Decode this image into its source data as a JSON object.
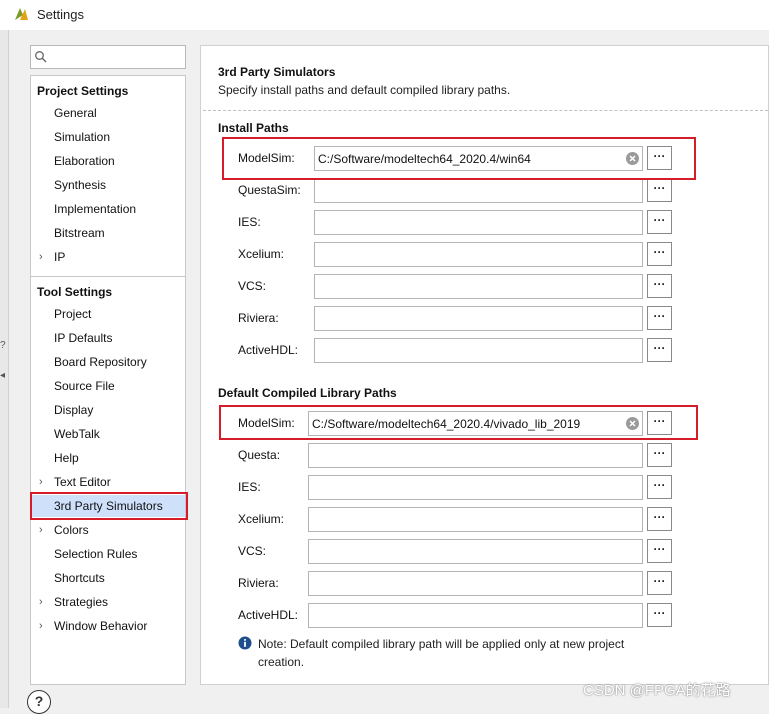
{
  "window": {
    "title": "Settings"
  },
  "search": {
    "placeholder": ""
  },
  "sidebar": {
    "project_settings_header": "Project Settings",
    "project_items": [
      "General",
      "Simulation",
      "Elaboration",
      "Synthesis",
      "Implementation",
      "Bitstream",
      "IP"
    ],
    "tool_settings_header": "Tool Settings",
    "tool_items": [
      "Project",
      "IP Defaults",
      "Board Repository",
      "Source File",
      "Display",
      "WebTalk",
      "Help",
      "Text Editor",
      "3rd Party Simulators",
      "Colors",
      "Selection Rules",
      "Shortcuts",
      "Strategies",
      "Window Behavior"
    ],
    "selected_item": "3rd Party Simulators"
  },
  "main": {
    "title": "3rd Party Simulators",
    "description": "Specify install paths and default compiled library paths.",
    "install_paths": {
      "header": "Install Paths",
      "rows": [
        {
          "label": "ModelSim:",
          "value": "C:/Software/modeltech64_2020.4/win64"
        },
        {
          "label": "QuestaSim:",
          "value": ""
        },
        {
          "label": "IES:",
          "value": ""
        },
        {
          "label": "Xcelium:",
          "value": ""
        },
        {
          "label": "VCS:",
          "value": ""
        },
        {
          "label": "Riviera:",
          "value": ""
        },
        {
          "label": "ActiveHDL:",
          "value": ""
        }
      ]
    },
    "library_paths": {
      "header": "Default Compiled Library Paths",
      "rows": [
        {
          "label": "ModelSim:",
          "value": "C:/Software/modeltech64_2020.4/vivado_lib_2019"
        },
        {
          "label": "Questa:",
          "value": ""
        },
        {
          "label": "IES:",
          "value": ""
        },
        {
          "label": "Xcelium:",
          "value": ""
        },
        {
          "label": "VCS:",
          "value": ""
        },
        {
          "label": "Riviera:",
          "value": ""
        },
        {
          "label": "ActiveHDL:",
          "value": ""
        }
      ]
    },
    "browse_label": "···",
    "note": "Note: Default compiled library path will be applied only at new project creation."
  },
  "help_button": {
    "label": "?"
  },
  "watermark": "CSDN @FPGA的花路",
  "colors": {
    "highlight": "#d61c28",
    "selection": "#cfe0fa",
    "info": "#1f4e8c"
  },
  "icons": [
    "vivado-logo-icon",
    "search-icon",
    "chevron-right-icon",
    "clear-icon",
    "info-icon"
  ]
}
